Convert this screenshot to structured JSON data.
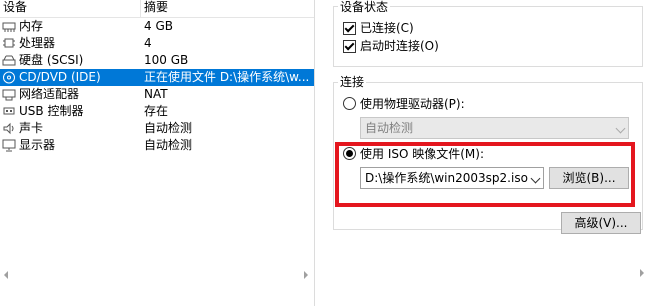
{
  "device_list": {
    "headers": {
      "device": "设备",
      "summary": "摘要"
    },
    "rows": [
      {
        "name": "内存",
        "value": "4 GB",
        "icon": "memory-icon"
      },
      {
        "name": "处理器",
        "value": "4",
        "icon": "processor-icon"
      },
      {
        "name": "硬盘 (SCSI)",
        "value": "100 GB",
        "icon": "hard-disk-icon"
      },
      {
        "name": "CD/DVD (IDE)",
        "value": "正在使用文件 D:\\操作系统\\w...",
        "icon": "cd-dvd-icon"
      },
      {
        "name": "网络适配器",
        "value": "NAT",
        "icon": "network-adapter-icon"
      },
      {
        "name": "USB 控制器",
        "value": "存在",
        "icon": "usb-controller-icon"
      },
      {
        "name": "声卡",
        "value": "自动检测",
        "icon": "sound-card-icon"
      },
      {
        "name": "显示器",
        "value": "自动检测",
        "icon": "display-icon"
      }
    ],
    "selected_index": 3
  },
  "device_status": {
    "title": "设备状态",
    "connected": {
      "label": "已连接(C)",
      "checked": true
    },
    "connect_on_power": {
      "label": "启动时连接(O)",
      "checked": true
    }
  },
  "connection": {
    "title": "连接",
    "physical_drive": {
      "label": "使用物理驱动器(P):",
      "selected": false
    },
    "physical_drive_value": "自动检测",
    "iso_image": {
      "label": "使用 ISO 映像文件(M):",
      "selected": true
    },
    "iso_path": "D:\\操作系统\\win2003sp2.iso",
    "browse_label": "浏览(B)..."
  },
  "advanced_label": "高级(V)...",
  "colors": {
    "selection": "#0078d7",
    "highlight_box": "#e4161e"
  }
}
